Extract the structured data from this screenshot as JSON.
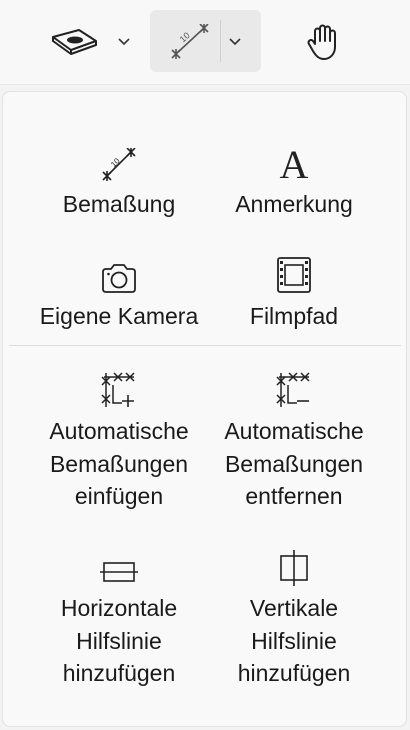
{
  "toolbar": {
    "icons": [
      "view-3d-icon",
      "dimension-icon",
      "hand-pan-icon"
    ]
  },
  "menu": {
    "items": [
      {
        "label": "Bemaßung",
        "icon": "dimension-icon"
      },
      {
        "label": "Anmerkung",
        "icon": "annotation-text-icon"
      },
      {
        "label": "Eigene Kamera",
        "icon": "camera-icon"
      },
      {
        "label": "Filmpfad",
        "icon": "film-strip-icon"
      },
      {
        "label": "Automatische\nBemaßungen\neinfügen",
        "icon": "auto-dimension-add-icon"
      },
      {
        "label": "Automatische\nBemaßungen\nentfernen",
        "icon": "auto-dimension-remove-icon"
      },
      {
        "label": "Horizontale\nHilfslinie\nhinzufügen",
        "icon": "horizontal-guide-icon"
      },
      {
        "label": "Vertikale\nHilfslinie\nhinzufügen",
        "icon": "vertical-guide-icon"
      }
    ]
  }
}
